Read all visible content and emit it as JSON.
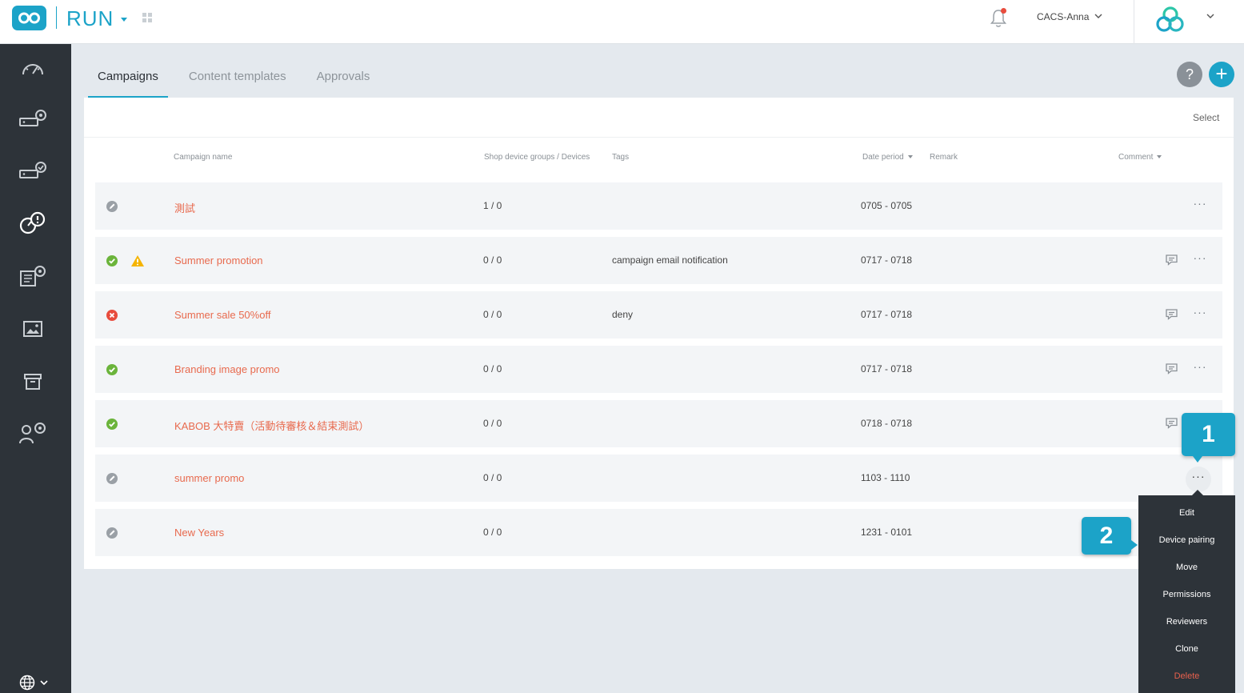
{
  "header": {
    "app_name": "RUN",
    "user_name": "CACS-Anna"
  },
  "tabs": [
    {
      "label": "Campaigns",
      "active": true
    },
    {
      "label": "Content templates",
      "active": false
    },
    {
      "label": "Approvals",
      "active": false
    }
  ],
  "actions": {
    "help_label": "?",
    "add_label": "+"
  },
  "panel": {
    "select_label": "Select",
    "columns": {
      "name": "Campaign name",
      "devices": "Shop device groups / Devices",
      "tags": "Tags",
      "period": "Date period",
      "remark": "Remark",
      "comment": "Comment"
    }
  },
  "campaigns": [
    {
      "status": "grey",
      "warning": false,
      "name": "測試",
      "devices": "1 / 0",
      "tags": "",
      "period": "0705 - 0705",
      "has_comment": false
    },
    {
      "status": "green",
      "warning": true,
      "name": "Summer promotion",
      "devices": "0 / 0",
      "tags": "campaign email notification",
      "period": "0717 - 0718",
      "has_comment": true
    },
    {
      "status": "red",
      "warning": false,
      "name": "Summer sale 50%off",
      "devices": "0 / 0",
      "tags": "deny",
      "period": "0717 - 0718",
      "has_comment": true
    },
    {
      "status": "green",
      "warning": false,
      "name": "Branding image promo",
      "devices": "0 / 0",
      "tags": "",
      "period": "0717 - 0718",
      "has_comment": true
    },
    {
      "status": "green",
      "warning": false,
      "name": "KABOB 大特賣（活動待審核＆結束測試）",
      "devices": "0 / 0",
      "tags": "",
      "period": "0718 - 0718",
      "has_comment": true
    },
    {
      "status": "grey",
      "warning": false,
      "name": "summer promo",
      "devices": "0 / 0",
      "tags": "",
      "period": "1103 - 1110",
      "has_comment": false
    },
    {
      "status": "grey",
      "warning": false,
      "name": "New Years",
      "devices": "0 / 0",
      "tags": "",
      "period": "1231 - 0101",
      "has_comment": false
    }
  ],
  "more_label": "···",
  "context_menu": {
    "items": [
      "Edit",
      "Device pairing",
      "Move",
      "Permissions",
      "Reviewers",
      "Clone",
      "Delete"
    ]
  },
  "callouts": {
    "first": "1",
    "second": "2"
  },
  "colors": {
    "accent": "#1ca3c8",
    "link": "#e86a4e",
    "sidebar": "#2d3339",
    "status_green": "#6bb43b",
    "status_red": "#e84c3d",
    "status_grey": "#9aa0a6",
    "warning": "#f5b400"
  }
}
